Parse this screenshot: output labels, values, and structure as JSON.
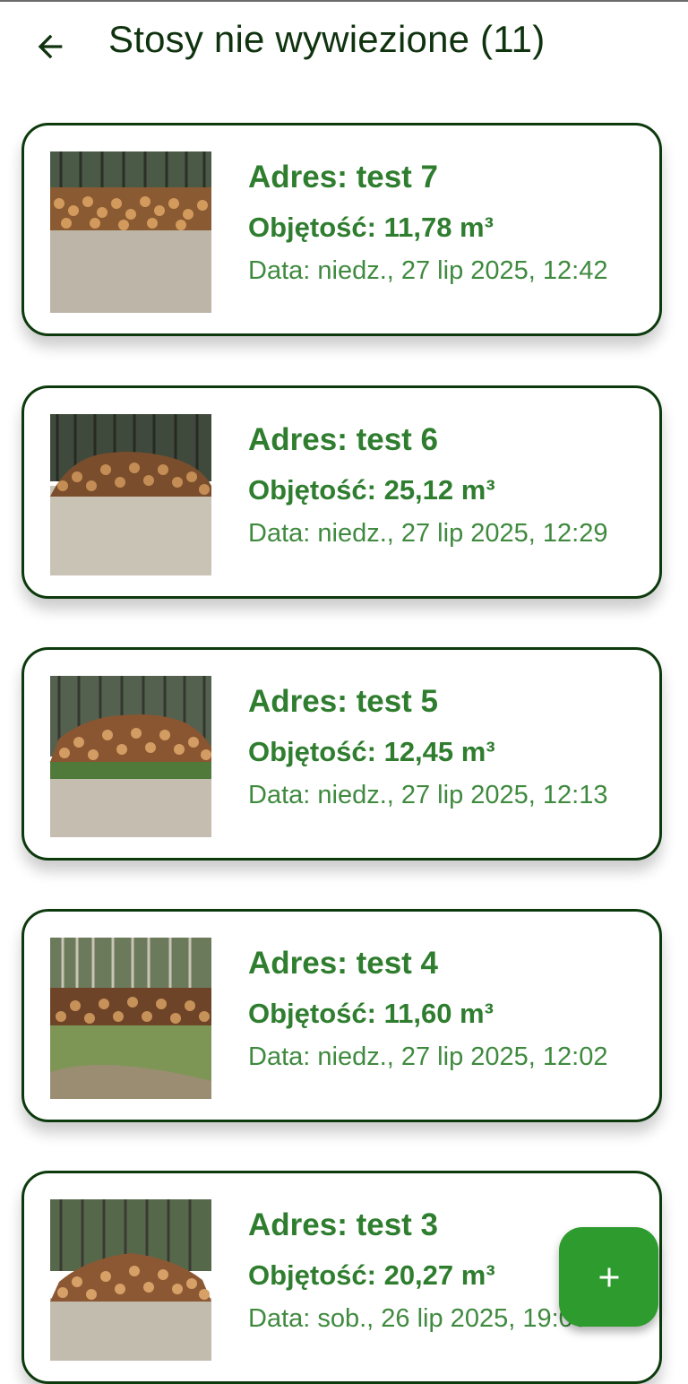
{
  "header": {
    "title": "Stosy nie wywiezione (11)",
    "back_icon": "arrow-back-icon"
  },
  "colors": {
    "primary_dark": "#10330f",
    "card_border": "#0d3a0d",
    "text_green": "#2f7d2f",
    "fab": "#2e9b2e"
  },
  "piles": [
    {
      "address": "Adres: test 7",
      "volume": "Objętość: 11,78 m³",
      "date": "Data: niedz., 27 lip 2025, 12:42"
    },
    {
      "address": "Adres: test 6",
      "volume": "Objętość: 25,12 m³",
      "date": "Data: niedz., 27 lip 2025, 12:29"
    },
    {
      "address": "Adres: test 5",
      "volume": "Objętość: 12,45 m³",
      "date": "Data: niedz., 27 lip 2025, 12:13"
    },
    {
      "address": "Adres: test 4",
      "volume": "Objętość: 11,60 m³",
      "date": "Data: niedz., 27 lip 2025, 12:02"
    },
    {
      "address": "Adres: test 3",
      "volume": "Objętość: 20,27 m³",
      "date": "Data: sob., 26 lip 2025, 19:06"
    }
  ],
  "fab": {
    "icon": "plus-icon"
  }
}
